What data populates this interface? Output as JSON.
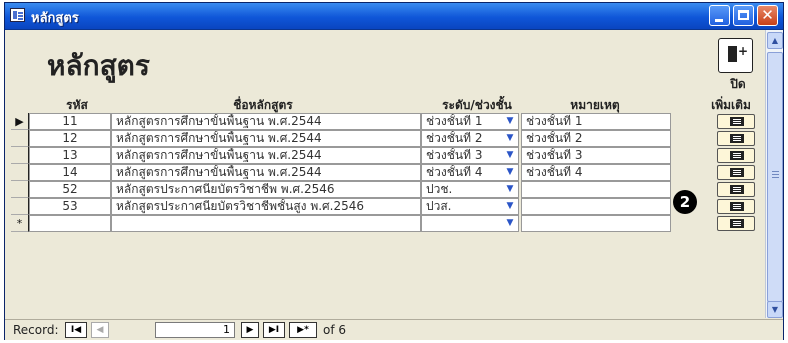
{
  "window": {
    "title": "หลักสูตร"
  },
  "header": {
    "title": "หลักสูตร",
    "exit_label": "ปิด"
  },
  "columns": {
    "code": "รหัส",
    "name": "ชื่อหลักสูตร",
    "level": "ระดับ/ช่วงชั้น",
    "note": "หมายเหตุ",
    "more": "เพิ่มเติม"
  },
  "rows": [
    {
      "code": "11",
      "name": "หลักสูตรการศึกษาขั้นพื้นฐาน พ.ศ.2544",
      "level": "ช่วงชั้นที่ 1",
      "note": "ช่วงชั้นที่ 1"
    },
    {
      "code": "12",
      "name": "หลักสูตรการศึกษาขั้นพื้นฐาน พ.ศ.2544",
      "level": "ช่วงชั้นที่ 2",
      "note": "ช่วงชั้นที่ 2"
    },
    {
      "code": "13",
      "name": "หลักสูตรการศึกษาขั้นพื้นฐาน พ.ศ.2544",
      "level": "ช่วงชั้นที่ 3",
      "note": "ช่วงชั้นที่ 3"
    },
    {
      "code": "14",
      "name": "หลักสูตรการศึกษาขั้นพื้นฐาน พ.ศ.2544",
      "level": "ช่วงชั้นที่ 4",
      "note": "ช่วงชั้นที่ 4"
    },
    {
      "code": "52",
      "name": "หลักสูตรประกาศนียบัตรวิชาชีพ พ.ศ.2546",
      "level": "ปวช.",
      "note": ""
    },
    {
      "code": "53",
      "name": "หลักสูตรประกาศนียบัตรวิชาชีพชั้นสูง พ.ศ.2546",
      "level": "ปวส.",
      "note": ""
    }
  ],
  "new_row_marker": "*",
  "current_row_marker": "▶",
  "callout": "2",
  "navigator": {
    "label": "Record:",
    "current": "1",
    "of_label": "of 6",
    "first": "I◀",
    "prev": "◀",
    "next": "▶",
    "last": "▶I",
    "new": "▶*"
  }
}
